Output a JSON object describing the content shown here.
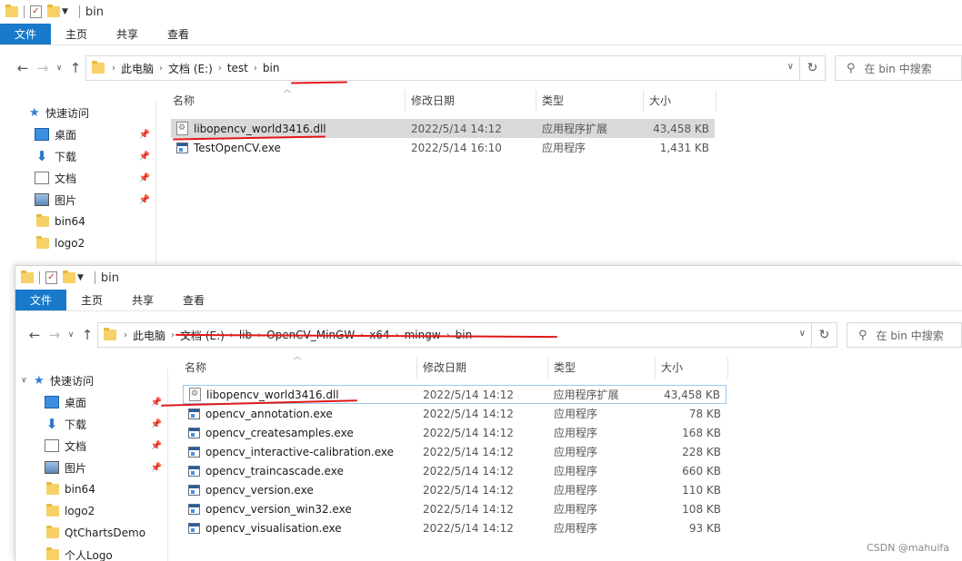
{
  "window1": {
    "title": "bin",
    "ribbon": [
      "文件",
      "主页",
      "共享",
      "查看"
    ],
    "breadcrumb": [
      "此电脑",
      "文档 (E:)",
      "test",
      "bin"
    ],
    "search_placeholder": "在 bin 中搜索",
    "nav": [
      {
        "label": "快速访问"
      },
      {
        "label": "桌面"
      },
      {
        "label": "下载"
      },
      {
        "label": "文档"
      },
      {
        "label": "图片"
      },
      {
        "label": "bin64"
      },
      {
        "label": "logo2"
      }
    ],
    "columns": [
      "名称",
      "修改日期",
      "类型",
      "大小"
    ],
    "files": [
      {
        "name": "libopencv_world3416.dll",
        "date": "2022/5/14 14:12",
        "type": "应用程序扩展",
        "size": "43,458 KB"
      },
      {
        "name": "TestOpenCV.exe",
        "date": "2022/5/14 16:10",
        "type": "应用程序",
        "size": "1,431 KB"
      }
    ]
  },
  "window2": {
    "title": "bin",
    "ribbon": [
      "文件",
      "主页",
      "共享",
      "查看"
    ],
    "breadcrumb": [
      "此电脑",
      "文档 (E:)",
      "lib",
      "OpenCV_MinGW",
      "x64",
      "mingw",
      "bin"
    ],
    "search_placeholder": "在 bin 中搜索",
    "nav": [
      {
        "label": "快速访问"
      },
      {
        "label": "桌面"
      },
      {
        "label": "下载"
      },
      {
        "label": "文档"
      },
      {
        "label": "图片"
      },
      {
        "label": "bin64"
      },
      {
        "label": "logo2"
      },
      {
        "label": "QtChartsDemo"
      },
      {
        "label": "个人Logo"
      }
    ],
    "columns": [
      "名称",
      "修改日期",
      "类型",
      "大小"
    ],
    "files": [
      {
        "name": "libopencv_world3416.dll",
        "date": "2022/5/14 14:12",
        "type": "应用程序扩展",
        "size": "43,458 KB"
      },
      {
        "name": "opencv_annotation.exe",
        "date": "2022/5/14 14:12",
        "type": "应用程序",
        "size": "78 KB"
      },
      {
        "name": "opencv_createsamples.exe",
        "date": "2022/5/14 14:12",
        "type": "应用程序",
        "size": "168 KB"
      },
      {
        "name": "opencv_interactive-calibration.exe",
        "date": "2022/5/14 14:12",
        "type": "应用程序",
        "size": "228 KB"
      },
      {
        "name": "opencv_traincascade.exe",
        "date": "2022/5/14 14:12",
        "type": "应用程序",
        "size": "660 KB"
      },
      {
        "name": "opencv_version.exe",
        "date": "2022/5/14 14:12",
        "type": "应用程序",
        "size": "110 KB"
      },
      {
        "name": "opencv_version_win32.exe",
        "date": "2022/5/14 14:12",
        "type": "应用程序",
        "size": "108 KB"
      },
      {
        "name": "opencv_visualisation.exe",
        "date": "2022/5/14 14:12",
        "type": "应用程序",
        "size": "93 KB"
      }
    ]
  },
  "watermark": "CSDN @mahuifa",
  "colors": {
    "ribbon_file": "#1979ca",
    "annotation": "#e01818",
    "selection": "#d9d9d9"
  }
}
